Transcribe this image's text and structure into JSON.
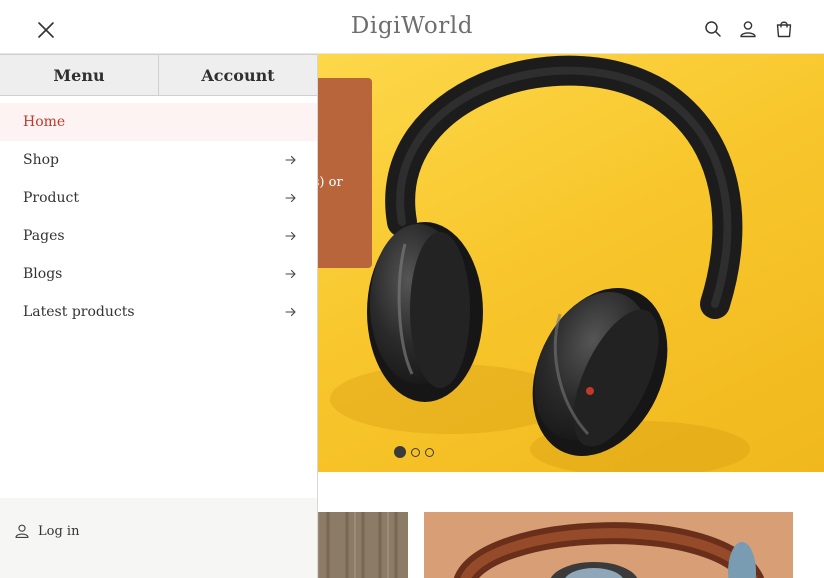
{
  "header": {
    "logo": "DigiWorld"
  },
  "hero": {
    "promo_text_fragment": "e(s) or",
    "slides_total": 3,
    "active_slide": 1
  },
  "drawer": {
    "tabs": [
      {
        "label": "Menu"
      },
      {
        "label": "Account"
      }
    ],
    "items": [
      {
        "label": "Home",
        "active": true
      },
      {
        "label": "Shop"
      },
      {
        "label": "Product"
      },
      {
        "label": "Pages"
      },
      {
        "label": "Blogs"
      },
      {
        "label": "Latest products"
      }
    ],
    "login_label": "Log in"
  },
  "colors": {
    "accent": "#c0392b",
    "promo_card": "#b9653c",
    "hero_bg": "#f7c52b"
  },
  "icons": [
    "close-icon",
    "search-icon",
    "user-icon",
    "cart-icon",
    "arrow-right-icon"
  ]
}
